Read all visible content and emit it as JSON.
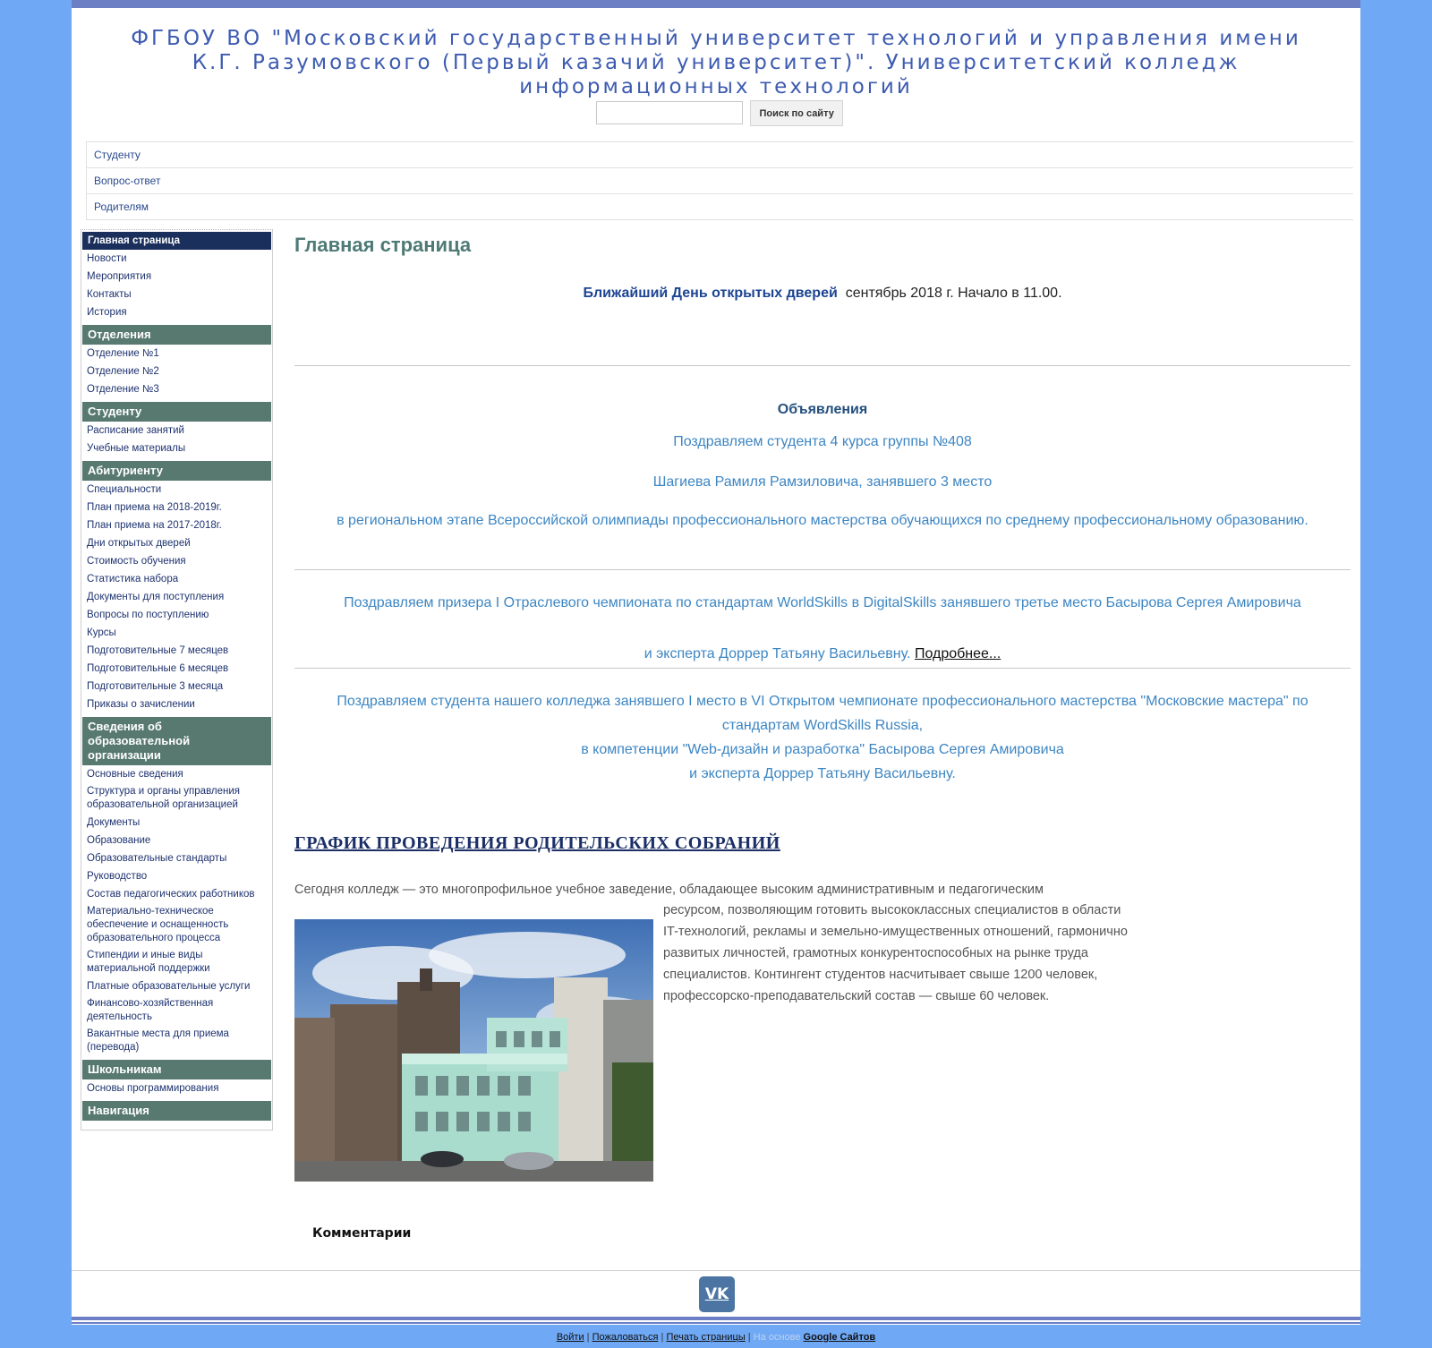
{
  "header": {
    "title": "ФГБОУ ВО \"Московский государственный университет технологий и управления имени К.Г. Разумовского (Первый казачий университет)\". Университетский колледж информационных технологий",
    "search_placeholder": "",
    "search_button": "Поиск по сайту"
  },
  "topnav": [
    "Студенту",
    "Вопрос-ответ",
    "Родителям"
  ],
  "sidebar": {
    "top_items": [
      "Главная страница",
      "Новости",
      "Мероприятия",
      "Контакты",
      "История"
    ],
    "sections": [
      {
        "title": "Отделения",
        "items": [
          "Отделение №1",
          "Отделение №2",
          "Отделение №3"
        ]
      },
      {
        "title": "Студенту",
        "items": [
          "Расписание занятий",
          "Учебные материалы"
        ]
      },
      {
        "title": "Абитуриенту",
        "items": [
          "Специальности",
          "План приема на 2018-2019г.",
          "План приема на 2017-2018г.",
          "Дни открытых дверей",
          "Стоимость обучения",
          "Статистика набора",
          "Документы для поступления",
          "Вопросы по поступлению",
          "Курсы",
          "Подготовительные 7 месяцев",
          "Подготовительные 6 месяцев",
          "Подготовительные 3 месяца",
          "Приказы о зачислении"
        ]
      },
      {
        "title": "Сведения об образовательной организации",
        "items": [
          "Основные сведения",
          "Структура и органы управления образовательной организацией",
          "Документы",
          "Образование",
          "Образовательные стандарты",
          "Руководство",
          "Состав педагогических работников",
          "Материально-техническое обеспечение и оснащенность образовательного процесса",
          "Стипендии и иные виды материальной поддержки",
          "Платные образовательные услуги",
          "Финансово-хозяйственная деятельность",
          "Вакантные места для приема (перевода)"
        ]
      },
      {
        "title": "Школьникам",
        "items": [
          "Основы программирования"
        ]
      },
      {
        "title": "Навигация",
        "items": []
      }
    ]
  },
  "main": {
    "page_title": "Главная страница",
    "open_day_highlight": "Ближайший День открытых дверей",
    "open_day_text": "сентябрь 2018 г. Начало в 11.00.",
    "announcements_title": "Объявления",
    "ann1_line1": "Поздравляем студента 4 курса группы №408",
    "ann1_line2": "Шагиева Рамиля Рамзиловича,  занявшего  3 место",
    "ann1_line3": "в региональном этапе Всероссийской олимпиады профессионального мастерства обучающихся по среднему профессиональному образованию.",
    "ann2_line1": "Поздравляем призера I Отраслевого чемпионата по стандартам WorldSkills в DigitalSkills занявшего третье место Басырова Сергея Амировича",
    "ann2_line2": "и эксперта Доррер Татьяну Васильевну.",
    "ann2_more": "Подробнее...",
    "ann3_line1": "Поздравляем студента нашего колледжа занявшего I место в VI Открытом чемпионате профессионального мастерства \"Московские мастера\" по стандартам WordSkills  Russia,",
    "ann3_line2": "в компетенции \"Web-дизайн и разработка\" Басырова Сергея Амировича",
    "ann3_line3": "и эксперта Доррер Татьяну Васильевну.",
    "schedule_link": "ГРАФИК ПРОВЕДЕНИЯ РОДИТЕЛЬСКИХ СОБРАНИЙ",
    "about_first": "Сегодня колледж — это многопрофильное учебное заведение, обладающее высоким административным и педагогическим",
    "about_rest": "ресурсом, позволяющим готовить высококлассных специалистов в области IT-технологий, рекламы и земельно-имущественных отношений, гармонично развитых личностей, грамотных конкурентоспособных на рынке труда специалистов. Контингент студентов насчитывает свыше 1200 человек, профессорско-преподавательский состав — свыше 60 человек.",
    "comments": "Комментарии"
  },
  "footer": {
    "vk_label": "VK",
    "login": "Войти",
    "report": "Пожаловаться",
    "print": "Печать страницы",
    "powered": "На основе",
    "google": "Google Сайтов",
    "separator": "|"
  }
}
